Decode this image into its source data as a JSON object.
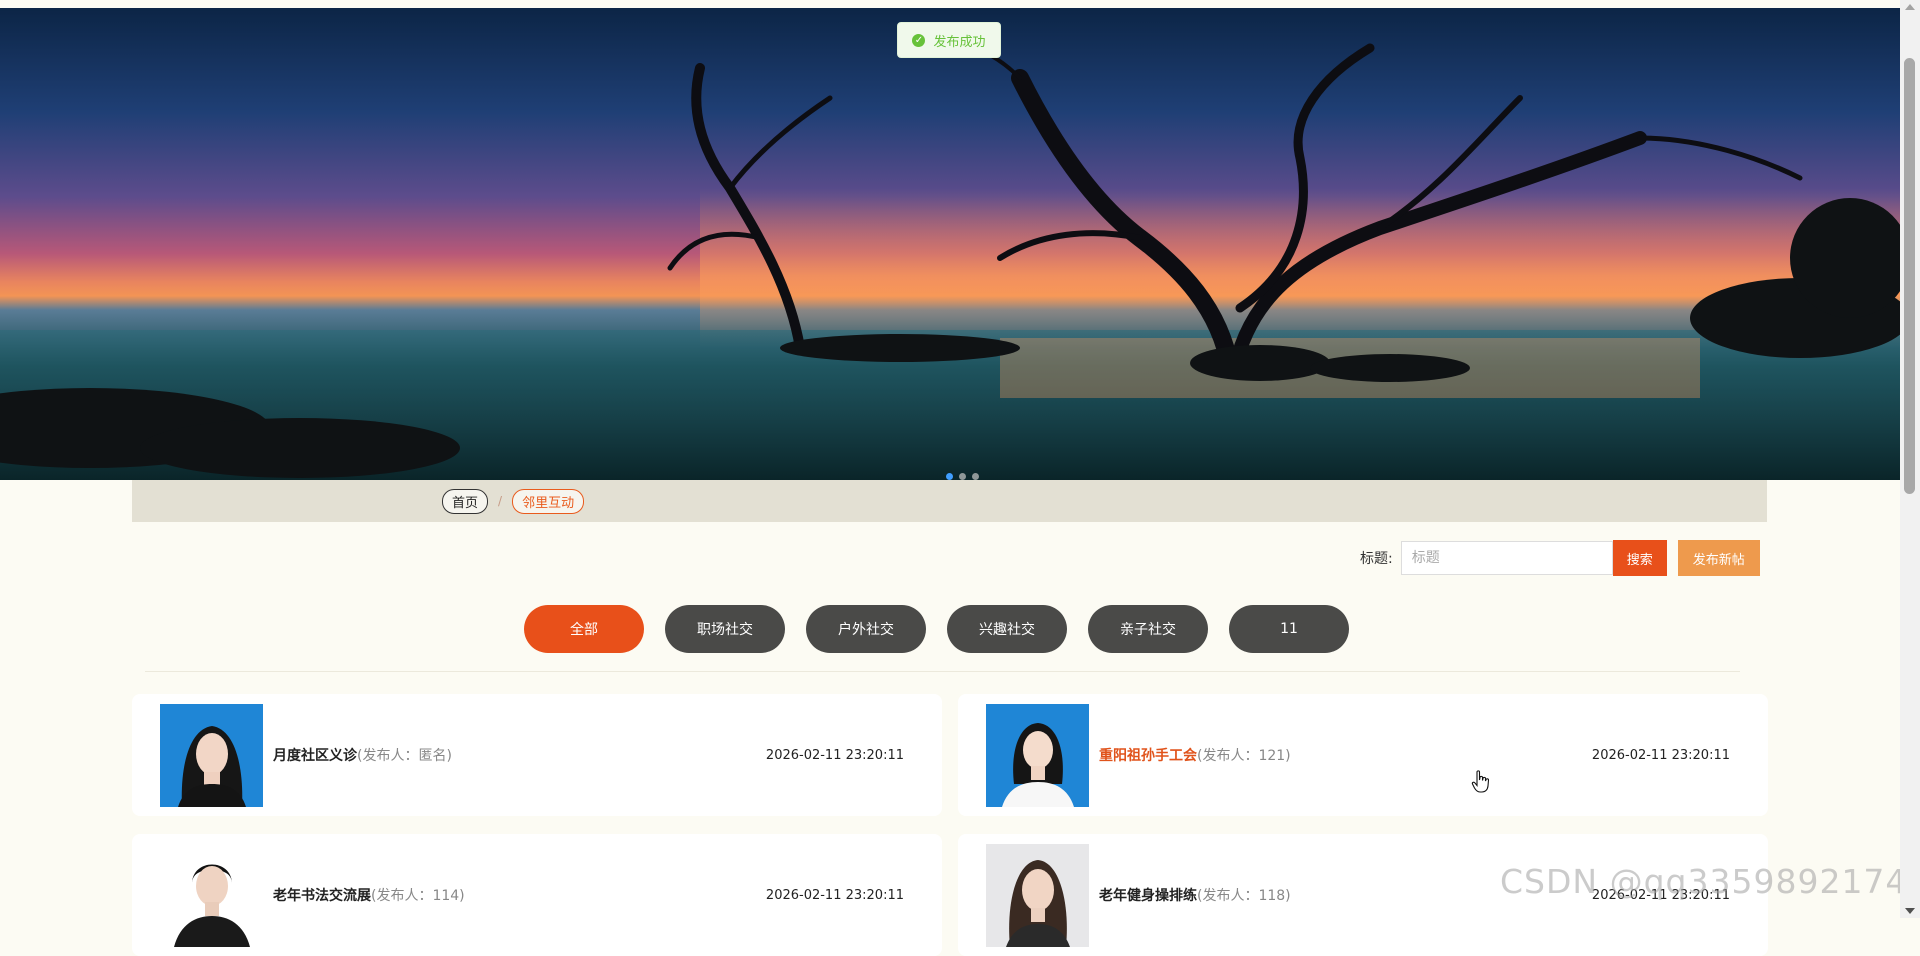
{
  "toast": {
    "icon": "check-circle-icon",
    "text": "发布成功"
  },
  "banner": {
    "slide_count": 3,
    "active_slide": 1
  },
  "breadcrumb": {
    "home": "首页",
    "separator": "/",
    "current": "邻里互动"
  },
  "search": {
    "label": "标题:",
    "placeholder": "标题",
    "value": "",
    "search_button": "搜索",
    "post_button": "发布新帖"
  },
  "categories": [
    {
      "label": "全部",
      "active": true
    },
    {
      "label": "职场社交",
      "active": false
    },
    {
      "label": "户外社交",
      "active": false
    },
    {
      "label": "兴趣社交",
      "active": false
    },
    {
      "label": "亲子社交",
      "active": false
    },
    {
      "label": "11",
      "active": false
    }
  ],
  "posts": [
    {
      "title": "月度社区义诊",
      "publisher": "(发布人：匿名)",
      "time": "2026-02-11 23:20:11",
      "highlighted": false
    },
    {
      "title": "重阳祖孙手工会",
      "publisher": "(发布人：121)",
      "time": "2026-02-11 23:20:11",
      "highlighted": true
    },
    {
      "title": "老年书法交流展",
      "publisher": "(发布人：114)",
      "time": "2026-02-11 23:20:11",
      "highlighted": false
    },
    {
      "title": "老年健身操排练",
      "publisher": "(发布人：118)",
      "time": "2026-02-11 23:20:11",
      "highlighted": false
    }
  ],
  "watermark": "CSDN @qq3359892174",
  "colors": {
    "accent": "#e8501a",
    "post_button": "#ee9a4d",
    "category_bg": "#4a4a48",
    "page_bg": "#fcfbf3",
    "success": "#67c23a"
  }
}
